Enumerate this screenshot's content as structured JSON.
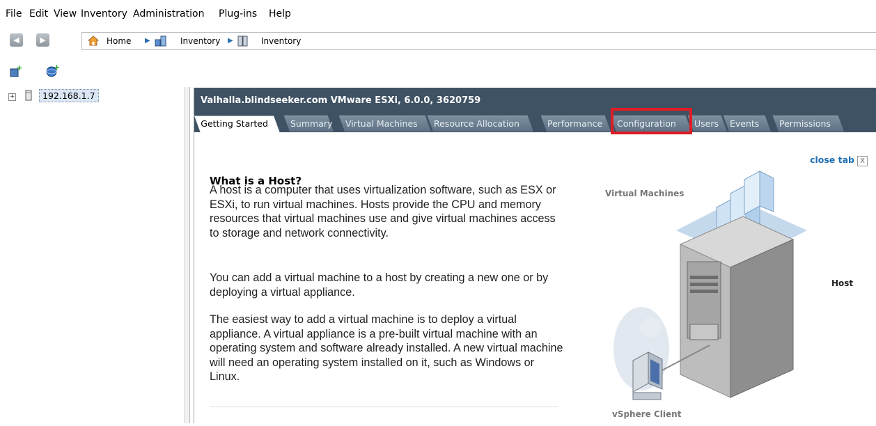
{
  "menu": [
    "File",
    "Edit",
    "View",
    "Inventory",
    "Administration",
    "Plug-ins",
    "Help"
  ],
  "nav": {
    "back_icon": "arrow-left-icon",
    "forward_icon": "arrow-right-icon",
    "breadcrumb": [
      "Home",
      "Inventory",
      "Inventory"
    ]
  },
  "toolbar_icons": [
    "add-host-icon",
    "new-datacenter-icon"
  ],
  "tree": {
    "host_ip": "192.168.1.7"
  },
  "host": {
    "title": "Valhalla.blindseeker.com VMware ESXi, 6.0.0, 3620759",
    "tabs": [
      {
        "label": "Getting Started",
        "active": true
      },
      {
        "label": "Summary",
        "active": false
      },
      {
        "label": "Virtual Machines",
        "active": false
      },
      {
        "label": "Resource Allocation",
        "active": false
      },
      {
        "label": "Performance",
        "active": false
      },
      {
        "label": "Configuration",
        "active": false
      },
      {
        "label": "Users",
        "active": false
      },
      {
        "label": "Events",
        "active": false
      },
      {
        "label": "Permissions",
        "active": false
      }
    ],
    "highlighted_tab_color": "#e01c24"
  },
  "content": {
    "close_tab": "close tab",
    "close_box": "X",
    "heading": "What is a Host?",
    "paragraphs": [
      "A host is a computer that uses virtualization software, such as ESX or ESXi, to run virtual machines. Hosts provide the CPU and memory resources that virtual machines use and give virtual machines access to storage and network connectivity.",
      "You can add a virtual machine to a host by creating a new one or by deploying a virtual appliance.",
      "The easiest way to add a virtual machine is to deploy a virtual appliance. A virtual appliance is a pre-built virtual machine with an operating system and software already installed. A new virtual machine will need an operating system installed on it, such as Windows or Linux."
    ],
    "diagram": {
      "vm_label": "Virtual Machines",
      "host_label": "Host",
      "client_label": "vSphere Client"
    }
  }
}
